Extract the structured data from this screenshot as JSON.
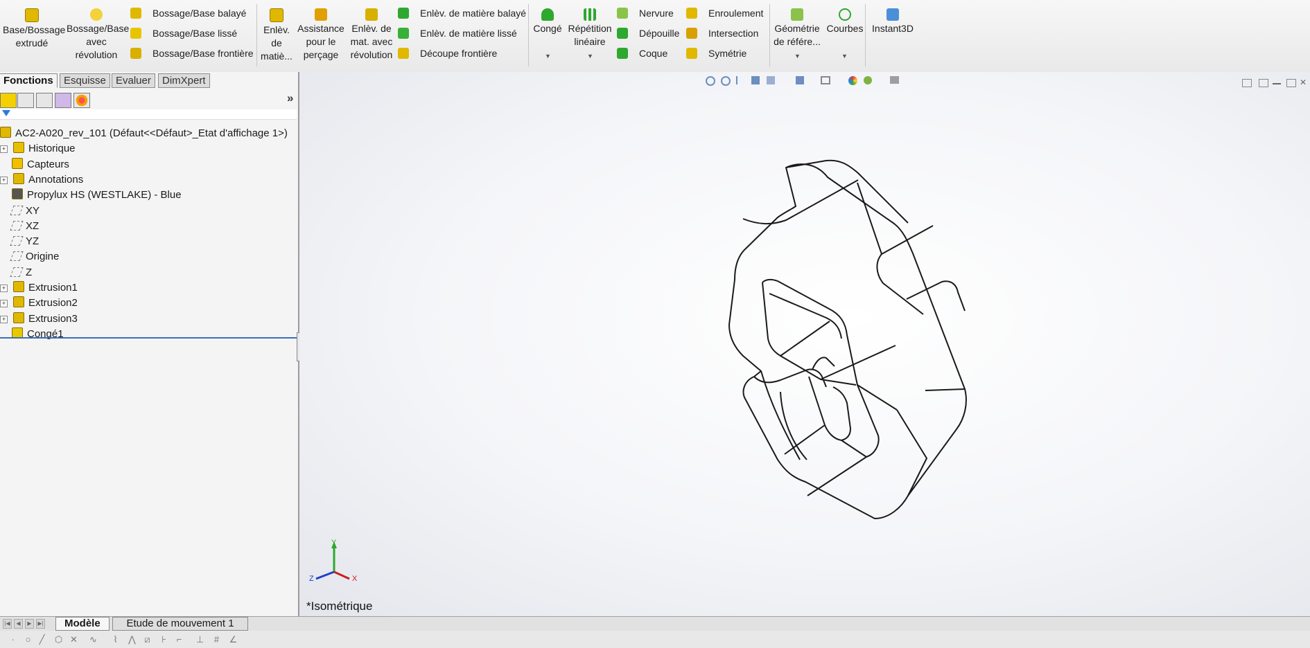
{
  "ribbon": {
    "big_buttons": [
      {
        "label": "Base/Bossage\nextrudé",
        "color": "#e0b800"
      },
      {
        "label": "Bossage/Base\navec\nrévolution",
        "color": "#e0b800"
      },
      {
        "label": "Enlèv.\nde\nmatiè...",
        "color": "#e0b800"
      },
      {
        "label": "Assistance\npour le\nperçage",
        "color": "#e0a000"
      },
      {
        "label": "Enlèv. de\nmat. avec\nrévolution",
        "color": "#d8b000"
      },
      {
        "label": "Congé",
        "color": "#2ea82e"
      },
      {
        "label": "Répétition\nlinéaire",
        "color": "#2ea82e"
      },
      {
        "label": "Géométrie\nde référe...",
        "color": "#8bc34a"
      },
      {
        "label": "Courbes",
        "color": "#2ea82e"
      },
      {
        "label": "Instant3D",
        "color": "#4a90d9"
      }
    ],
    "small_items": [
      {
        "label": "Bossage/Base balayé",
        "color": "#e0b800"
      },
      {
        "label": "Bossage/Base lissé",
        "color": "#e0b800"
      },
      {
        "label": "Bossage/Base frontière",
        "color": "#e0b800"
      },
      {
        "label": "Enlèv. de matière balayé",
        "color": "#2ea82e"
      },
      {
        "label": "Enlèv. de matière lissé",
        "color": "#2ea82e"
      },
      {
        "label": "Découpe frontière",
        "color": "#e0b800"
      },
      {
        "label": "Nervure",
        "color": "#2ea82e"
      },
      {
        "label": "Dépouille",
        "color": "#2ea82e"
      },
      {
        "label": "Coque",
        "color": "#2ea82e"
      },
      {
        "label": "Enroulement",
        "color": "#e0b800"
      },
      {
        "label": "Intersection",
        "color": "#e0b800"
      },
      {
        "label": "Symétrie",
        "color": "#e0b800"
      }
    ]
  },
  "panel": {
    "tabs": [
      "Fonctions",
      "Esquisse",
      "Evaluer",
      "DimXpert"
    ],
    "expand_label": "»",
    "tree": [
      {
        "label": "AC2-A020_rev_101  (Défaut<<Défaut>_Etat d'affichage 1>)",
        "icon": "part-icon"
      },
      {
        "label": "Historique",
        "icon": "history-icon",
        "expandable": true
      },
      {
        "label": "Capteurs",
        "icon": "sensor-icon",
        "expandable": false
      },
      {
        "label": "Annotations",
        "icon": "annotations-icon",
        "expandable": true
      },
      {
        "label": "Propylux HS (WESTLAKE) - Blue",
        "icon": "material-icon",
        "expandable": false
      },
      {
        "label": "XY",
        "icon": "plane-icon",
        "expandable": false
      },
      {
        "label": "XZ",
        "icon": "plane-icon",
        "expandable": false
      },
      {
        "label": "YZ",
        "icon": "plane-icon",
        "expandable": false
      },
      {
        "label": "Origine",
        "icon": "origin-icon",
        "expandable": false
      },
      {
        "label": "Z",
        "icon": "axis-icon",
        "expandable": false
      },
      {
        "label": "Extrusion1",
        "icon": "extrude-icon",
        "expandable": true
      },
      {
        "label": "Extrusion2",
        "icon": "extrude-icon",
        "expandable": true
      },
      {
        "label": "Extrusion3",
        "icon": "extrude-icon",
        "expandable": true
      },
      {
        "label": "Congé1",
        "icon": "fillet-icon",
        "expandable": false
      }
    ]
  },
  "graphics": {
    "view_name": "*Isométrique",
    "triad": {
      "x": "X",
      "y": "Y",
      "z": "Z"
    }
  },
  "bottom": {
    "tabs": [
      "Modèle",
      "Etude de mouvement 1"
    ]
  }
}
